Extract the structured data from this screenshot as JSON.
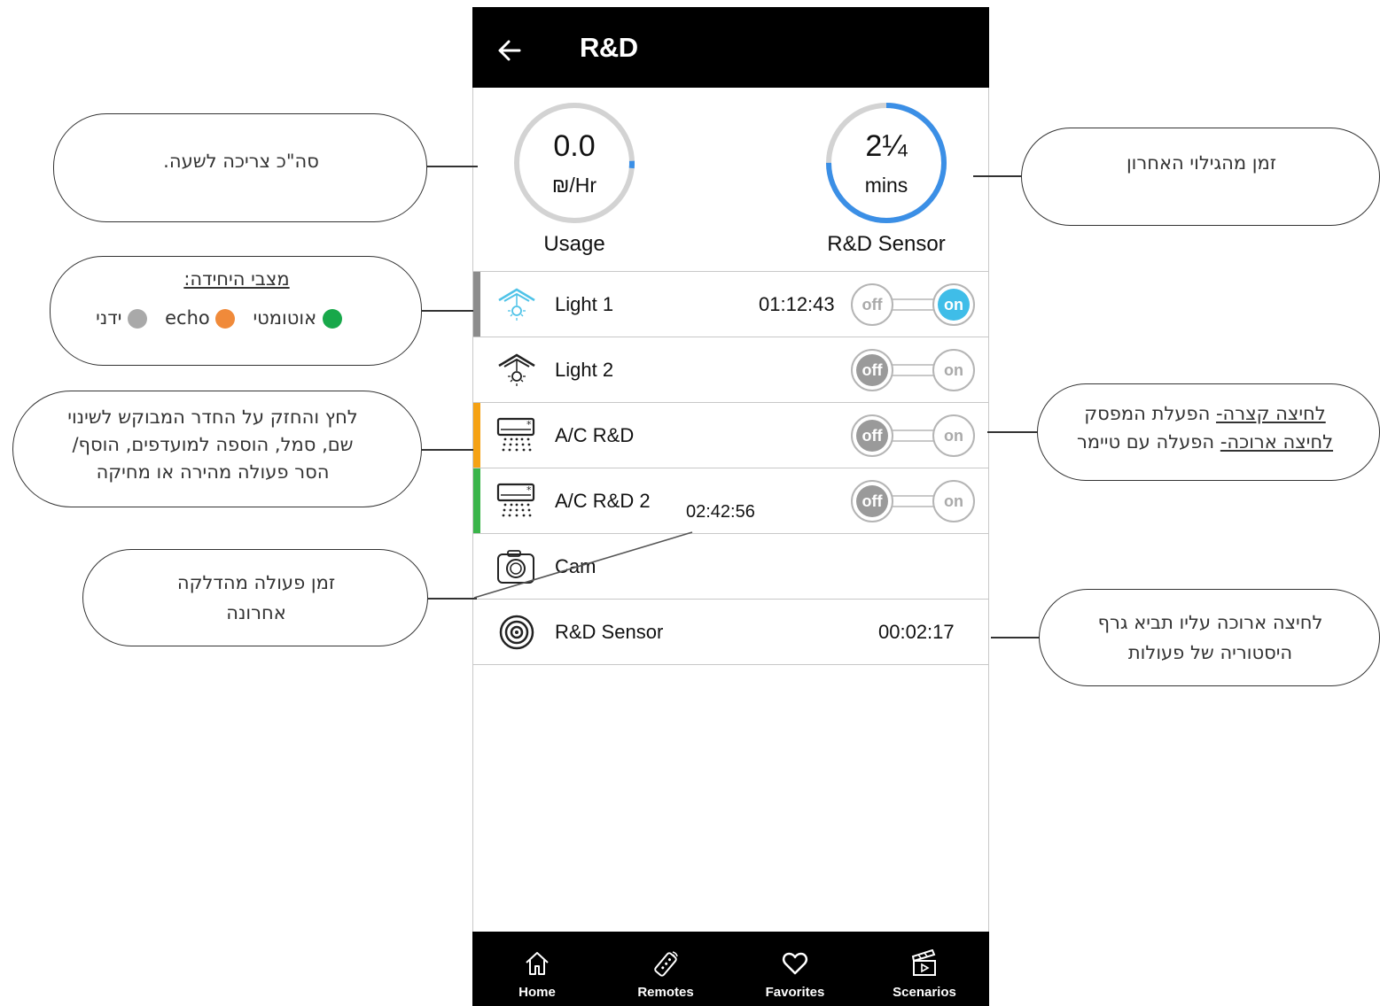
{
  "header": {
    "title": "R&D"
  },
  "gauges": {
    "usage": {
      "value": "0.0",
      "unit": "₪/Hr",
      "label": "Usage",
      "fraction": 0.02
    },
    "sensor": {
      "value": "2¼",
      "unit": "mins",
      "label": "R&D Sensor",
      "fraction": 0.75
    }
  },
  "devices": [
    {
      "name": "Light 1",
      "time": "01:12:43",
      "state": "on",
      "stripe": "#8c8c8c",
      "icon": "light-icon-active"
    },
    {
      "name": "Light 2",
      "time": "",
      "state": "off",
      "stripe": "",
      "icon": "light-icon"
    },
    {
      "name": "A/C R&D",
      "time": "",
      "state": "off",
      "stripe": "#f5a214",
      "icon": "ac-icon"
    },
    {
      "name": "A/C R&D 2",
      "time": "",
      "state": "off",
      "stripe": "#3ab54a",
      "icon": "ac-icon"
    },
    {
      "name": "Cam",
      "time": "",
      "icon": "camera-icon"
    },
    {
      "name": "R&D Sensor",
      "time": "00:02:17",
      "icon": "sensor-icon"
    }
  ],
  "toggle_labels": {
    "off": "off",
    "on": "on"
  },
  "overlay_time": "02:42:56",
  "nav": [
    {
      "label": "Home",
      "icon": "home-icon"
    },
    {
      "label": "Remotes",
      "icon": "remote-icon"
    },
    {
      "label": "Favorites",
      "icon": "heart-icon"
    },
    {
      "label": "Scenarios",
      "icon": "clapperboard-icon"
    }
  ],
  "annotations": {
    "usage": "סה\"כ צריכה לשעה.",
    "sensor": "זמן מהגילוי האחרון",
    "states_title": "מצבי היחידה:",
    "state_auto": "אוטומטי",
    "state_echo": "echo",
    "state_manual": "ידני",
    "state_colors": {
      "auto": "#18a84a",
      "echo": "#f08a3a",
      "manual": "#a9a9a9"
    },
    "room_line1": "לחץ והחזק על החדר המבוקש לשינוי",
    "room_line2": "שם, סמל, הוספה למועדפים, הוסף/",
    "room_line3": "הסר פעולה מהירה או מחיקה",
    "press_short": "לחיצה קצרה-",
    "press_short_rest": " הפעלת המפסק",
    "press_long": "לחיצה ארוכה-",
    "press_long_rest": " הפעלה עם טיימר",
    "last_action_line1": "זמן פעולה מהדלקה",
    "last_action_line2": "אחרונה",
    "history_line1": "לחיצה ארוכה עליו תביא גרף",
    "history_line2": "היסטוריה של פעולות"
  }
}
